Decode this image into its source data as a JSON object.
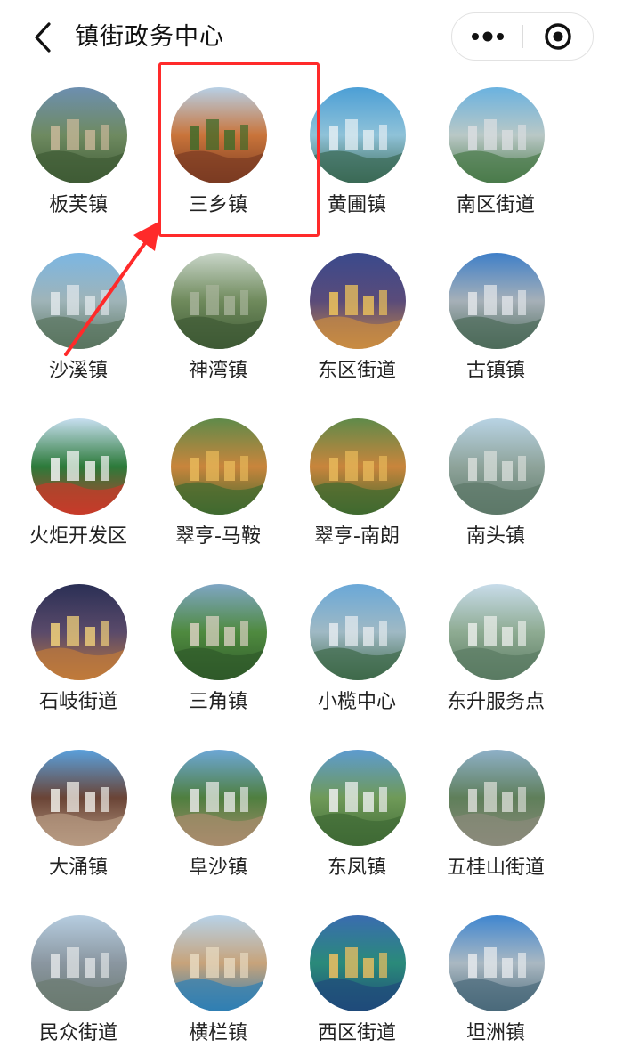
{
  "nav": {
    "title": "镇街政务中心"
  },
  "accent_color": "#ff2a2a",
  "items": [
    {
      "label": "板芙镇",
      "sky": "#6d8fb0",
      "mid": "#6e8a60",
      "low": "#3f5b35",
      "accent": "#c9b89a"
    },
    {
      "label": "三乡镇",
      "sky": "#b7d0e6",
      "mid": "#c9743a",
      "low": "#7a3b22",
      "accent": "#3f6b2a"
    },
    {
      "label": "黄圃镇",
      "sky": "#4c9fd6",
      "mid": "#8fc2d8",
      "low": "#3b6a55",
      "accent": "#e2edf3"
    },
    {
      "label": "南区街道",
      "sky": "#6ab2e0",
      "mid": "#b9c8c6",
      "low": "#4a7a4a",
      "accent": "#d9dde0"
    },
    {
      "label": "沙溪镇",
      "sky": "#7bb6e3",
      "mid": "#9fb4b8",
      "low": "#5a7560",
      "accent": "#dfe6ea"
    },
    {
      "label": "神湾镇",
      "sky": "#c9d6c9",
      "mid": "#6f8a5c",
      "low": "#3e5a35",
      "accent": "#a7b39a"
    },
    {
      "label": "东区街道",
      "sky": "#3a4a8c",
      "mid": "#5a4b7a",
      "low": "#c98b42",
      "accent": "#f0c45a"
    },
    {
      "label": "古镇镇",
      "sky": "#3f7fc8",
      "mid": "#a6b0b8",
      "low": "#4d6b5a",
      "accent": "#e0e4e8"
    },
    {
      "label": "火炬开发区",
      "sky": "#c7dff0",
      "mid": "#2c7a3a",
      "low": "#c73b2a",
      "accent": "#f5f5f5"
    },
    {
      "label": "翠亨-马鞍",
      "sky": "#5f8a4a",
      "mid": "#c9853c",
      "low": "#3f6a2f",
      "accent": "#e7b85a"
    },
    {
      "label": "翠亨-南朗",
      "sky": "#5f8a4a",
      "mid": "#c9853c",
      "low": "#3f6a2f",
      "accent": "#e7b85a"
    },
    {
      "label": "南头镇",
      "sky": "#b8d3e4",
      "mid": "#8ea39a",
      "low": "#5c7868",
      "accent": "#d7ddd9"
    },
    {
      "label": "石岐街道",
      "sky": "#2a2f55",
      "mid": "#5a4a6a",
      "low": "#c07a3a",
      "accent": "#f2d27a"
    },
    {
      "label": "三角镇",
      "sky": "#7fa6c4",
      "mid": "#4f8a3f",
      "low": "#2f5a2a",
      "accent": "#d8d0c0"
    },
    {
      "label": "小榄中心",
      "sky": "#6aa8d8",
      "mid": "#9fb9c4",
      "low": "#3f6a4a",
      "accent": "#e3eaee"
    },
    {
      "label": "东升服务点",
      "sky": "#c8dcea",
      "mid": "#8eab92",
      "low": "#5a7a62",
      "accent": "#e8ece8"
    },
    {
      "label": "大涌镇",
      "sky": "#5aa0dc",
      "mid": "#6a4436",
      "low": "#b79a82",
      "accent": "#f0eee8"
    },
    {
      "label": "阜沙镇",
      "sky": "#6da7d6",
      "mid": "#4f7f3f",
      "low": "#a88c6c",
      "accent": "#e6e8e6"
    },
    {
      "label": "东凤镇",
      "sky": "#5d9bd0",
      "mid": "#6f9a58",
      "low": "#3f6a35",
      "accent": "#eef0f0"
    },
    {
      "label": "五桂山街道",
      "sky": "#8eb0c8",
      "mid": "#5f7f5a",
      "low": "#8a8a7a",
      "accent": "#d9dcd6"
    },
    {
      "label": "民众街道",
      "sky": "#b6cde0",
      "mid": "#8a96a0",
      "low": "#6b7a70",
      "accent": "#e0e4e6"
    },
    {
      "label": "横栏镇",
      "sky": "#b7d2e8",
      "mid": "#c7a37a",
      "low": "#2f7fb3",
      "accent": "#e7d9c0"
    },
    {
      "label": "西区街道",
      "sky": "#3a6cb0",
      "mid": "#2a8a7a",
      "low": "#1f4a7a",
      "accent": "#f0c060"
    },
    {
      "label": "坦洲镇",
      "sky": "#3f86d0",
      "mid": "#aab8c2",
      "low": "#4a6a7a",
      "accent": "#e5e9ec"
    }
  ]
}
